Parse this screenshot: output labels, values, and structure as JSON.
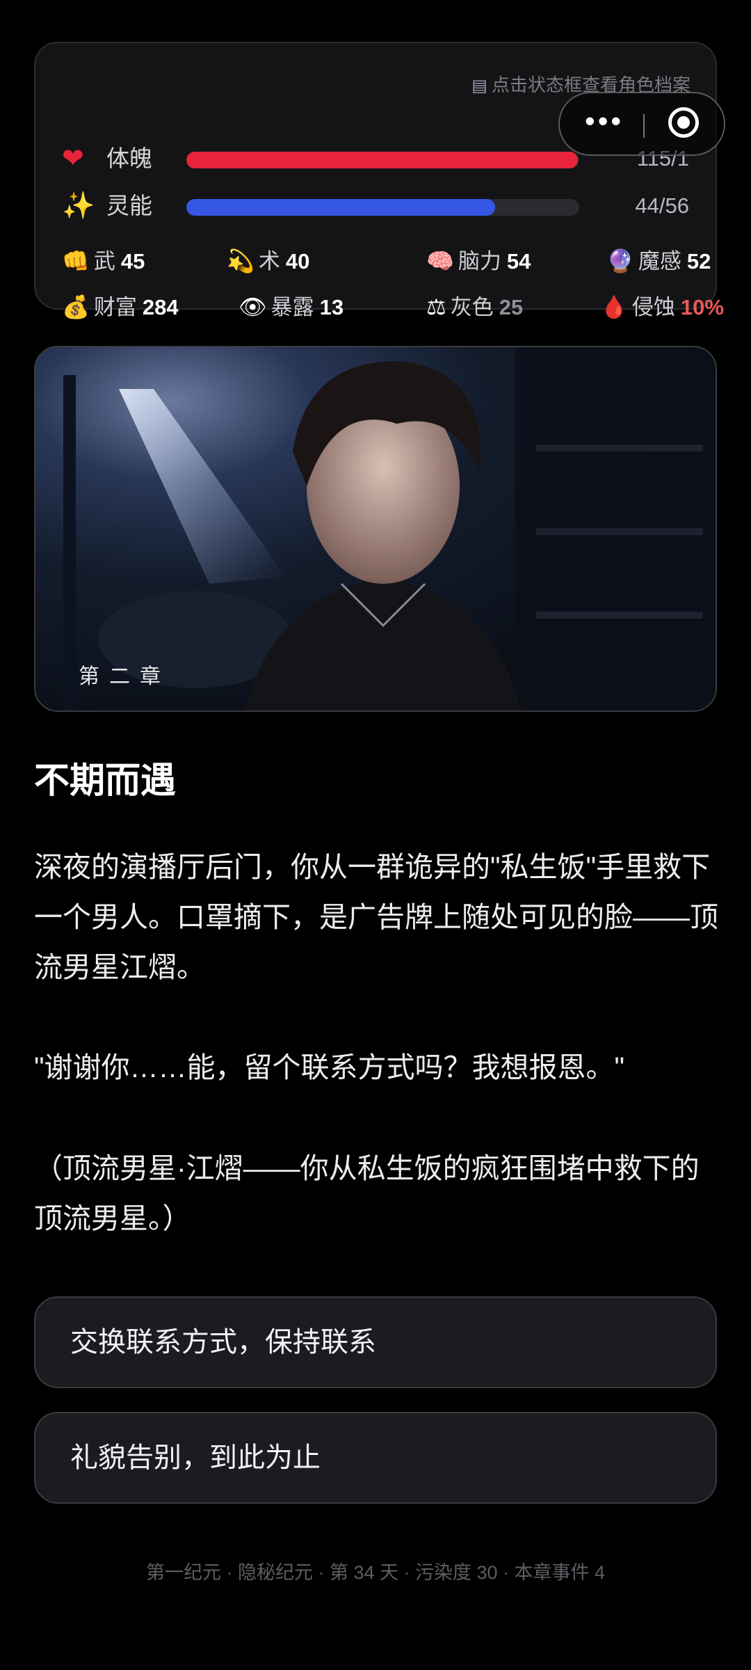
{
  "status_card": {
    "profile_hint": "点击状态框查看角色档案",
    "hp": {
      "label": "体魄",
      "value": "115/1",
      "fraction": 0.996
    },
    "mp": {
      "label": "灵能",
      "value": "44/56",
      "fraction": 0.786
    },
    "attributes_row1": [
      {
        "icon": "fist-icon",
        "glyph": "👊",
        "label": "武",
        "value": "45"
      },
      {
        "icon": "sparkle-icon",
        "glyph": "💫",
        "label": "术",
        "value": "40"
      },
      {
        "icon": "brain-icon",
        "glyph": "🧠",
        "label": "脑力",
        "value": "54"
      },
      {
        "icon": "crystal-ball-icon",
        "glyph": "🔮",
        "label": "魔感",
        "value": "52"
      }
    ],
    "attributes_row2": [
      {
        "icon": "money-bag-icon",
        "glyph": "💰",
        "label": "财富",
        "value": "284"
      },
      {
        "icon": "eye-icon",
        "glyph": "👁",
        "label": "暴露",
        "value": "13"
      },
      {
        "icon": "scales-icon",
        "glyph": "⚖",
        "label": "灰色",
        "value": "25"
      },
      {
        "icon": "blood-drop-icon",
        "glyph": "🩸",
        "label": "侵蚀",
        "value": "10%"
      }
    ]
  },
  "chapter": {
    "tag": "第二章",
    "title": "不期而遇",
    "paragraphs": [
      "深夜的演播厅后门，你从一群诡异的\"私生饭\"手里救下一个男人。口罩摘下，是广告牌上随处可见的脸——顶流男星江熠。",
      "\"谢谢你……能，留个联系方式吗？我想报恩。\"",
      "（顶流男星·江熠——你从私生饭的疯狂围堵中救下的顶流男星。）"
    ]
  },
  "choices": [
    "交换联系方式，保持联系",
    "礼貌告别，到此为止"
  ],
  "footer": "第一纪元 · 隐秘纪元 · 第 34 天 · 污染度 30 · 本章事件 4",
  "colors": {
    "hp": "#e8253a",
    "mp": "#3656e6",
    "erosion": "#ea5a5a",
    "background": "#000000"
  }
}
